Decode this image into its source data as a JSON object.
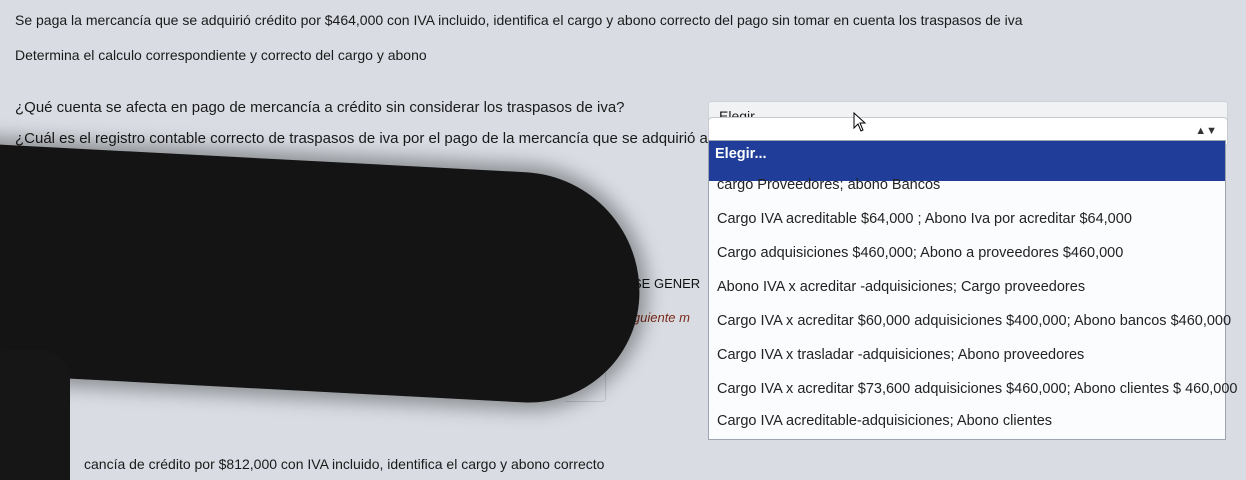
{
  "question": {
    "line1": "Se paga la mercancía que se adquirió crédito por $464,000 con IVA incluido, identifica el cargo y abono correcto del pago sin tomar en cuenta los traspasos de iva",
    "line2": "Determina el calculo correspondiente y correcto del cargo y abono",
    "prompt1": "¿Qué cuenta se afecta en pago de mercancía a crédito sin considerar los traspasos de iva?",
    "prompt2": "¿Cuál es el registro contable correcto de traspasos de iva por el pago de la mercancía que se adquirió a crédito?"
  },
  "select1": {
    "value": "Elegir..."
  },
  "dropdown": {
    "selected": "Elegir...",
    "options": [
      "cargo Proveedores; abono Bancos",
      "Cargo IVA acreditable $64,000 ; Abono Iva por acreditar $64,000",
      "Cargo adquisiciones $460,000; Abono a proveedores $460,000",
      "Abono IVA x acreditar -adquisiciones; Cargo proveedores",
      "Cargo IVA x acreditar $60,000 adquisiciones $400,000; Abono bancos $460,000",
      "Cargo IVA x trasladar -adquisiciones; Abono proveedores",
      "Cargo IVA x acreditar $73,600 adquisiciones $460,000; Abono clientes $ 460,000",
      "Cargo IVA acreditable-adquisiciones; Abono clientes"
    ]
  },
  "partial": {
    "peek1": "SE GENER",
    "peek2": "iguiente m",
    "bottom": "cancía de crédito por $812,000 con IVA incluido, identifica el cargo y abono correcto"
  }
}
